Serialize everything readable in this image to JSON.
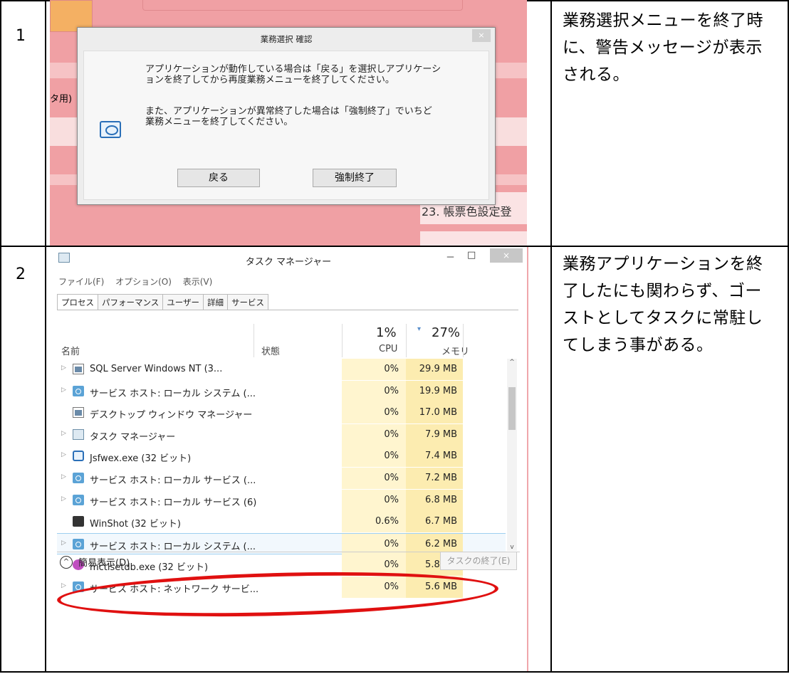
{
  "rows": [
    {
      "num": "1",
      "desc": "業務選択メニューを終了時に、警告メッセージが表示される。"
    },
    {
      "num": "2",
      "desc": "業務アプリケーションを終了したにも関わらず、ゴーストとしてタスクに常駐してしまう事がある。"
    }
  ],
  "dialog": {
    "title": "業務選択 確認",
    "close": "×",
    "msg1": "アプリケーションが動作している場合は「戻る」を選択しアプリケーシ\nョンを終了してから再度業務メニューを終了してください。",
    "msg2": "また、アプリケーションが異常終了した場合は「強制終了」でいちど\n業務メニューを終了してください。",
    "back_button": "戻る",
    "force_button": "強制終了",
    "bg_left_text": "タ用)",
    "bg_right_text": "23. 帳票色設定登"
  },
  "taskmgr": {
    "title": "タスク マネージャー",
    "minimize": "－",
    "maximize": "□",
    "close": "×",
    "menu": [
      "ファイル(F)",
      "オプション(O)",
      "表示(V)"
    ],
    "tabs": [
      "プロセス",
      "パフォーマンス",
      "ユーザー",
      "詳細",
      "サービス"
    ],
    "col_name": "名前",
    "col_status": "状態",
    "cpu_pct": "1%",
    "cpu_label": "CPU",
    "mem_pct": "27%",
    "mem_label": "メモリ",
    "processes": [
      {
        "name": "SQL Server Windows NT (3...",
        "cpu": "0%",
        "mem": "29.9 MB",
        "icon": "window-icon",
        "expand": true
      },
      {
        "name": "サービス ホスト: ローカル システム (...",
        "cpu": "0%",
        "mem": "19.9 MB",
        "icon": "gear-icon",
        "expand": true
      },
      {
        "name": "デスクトップ ウィンドウ マネージャー",
        "cpu": "0%",
        "mem": "17.0 MB",
        "icon": "window-icon",
        "expand": false
      },
      {
        "name": "タスク マネージャー",
        "cpu": "0%",
        "mem": "7.9 MB",
        "icon": "taskmgr-icon",
        "expand": true
      },
      {
        "name": "Jsfwex.exe (32 ビット)",
        "cpu": "0%",
        "mem": "7.4 MB",
        "icon": "app-icon",
        "expand": true
      },
      {
        "name": "サービス ホスト: ローカル サービス (...",
        "cpu": "0%",
        "mem": "7.2 MB",
        "icon": "gear-icon",
        "expand": true
      },
      {
        "name": "サービス ホスト: ローカル サービス (6)",
        "cpu": "0%",
        "mem": "6.8 MB",
        "icon": "gear-icon",
        "expand": true
      },
      {
        "name": "WinShot (32 ビット)",
        "cpu": "0.6%",
        "mem": "6.7 MB",
        "icon": "winshot-icon",
        "expand": false
      },
      {
        "name": "サービス ホスト: ローカル システム (...",
        "cpu": "0%",
        "mem": "6.2 MB",
        "icon": "gear-icon",
        "expand": true
      },
      {
        "name": "mctlsetdb.exe (32 ビット)",
        "cpu": "0%",
        "mem": "5.8 MB",
        "icon": "mctl-icon",
        "expand": false
      },
      {
        "name": "サービス ホスト: ネットワーク サービ...",
        "cpu": "0%",
        "mem": "5.6 MB",
        "icon": "gear-icon",
        "expand": true
      }
    ],
    "fewer_details": "簡易表示(D)",
    "end_task": "タスクの終了(E)",
    "fewer_glyph": "^",
    "expand_glyph": "▷",
    "scroll_up": "^",
    "scroll_down": "v"
  }
}
